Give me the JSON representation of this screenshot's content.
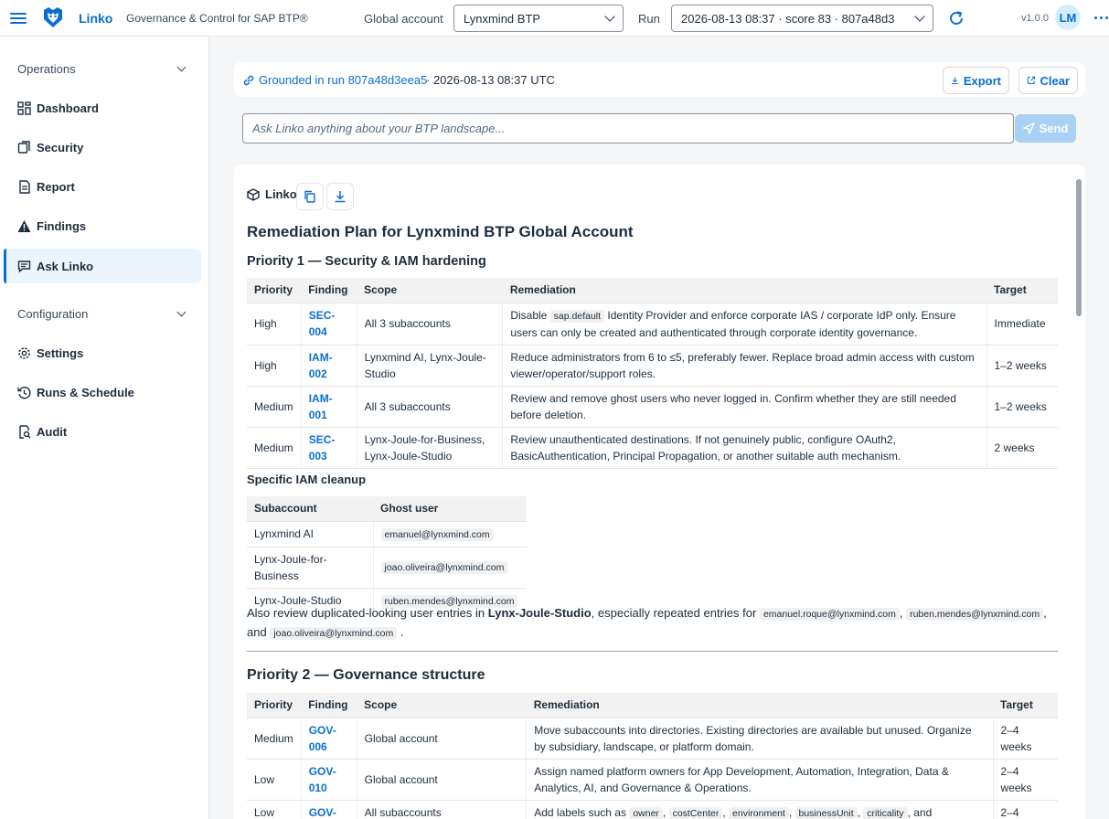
{
  "header": {
    "brand": "Linko",
    "tagline": "Governance & Control for SAP BTP®",
    "global_account_label": "Global account",
    "global_account_value": "Lynxmind BTP",
    "run_label": "Run",
    "run_value": "2026-08-13 08:37 · score 83 · 807a48d3",
    "version": "v1.0.0",
    "avatar_initials": "LM"
  },
  "sidebar": {
    "groups": [
      {
        "label": "Operations"
      },
      {
        "label": "Configuration"
      }
    ],
    "items": [
      {
        "label": "Dashboard",
        "icon": "dashboard-icon"
      },
      {
        "label": "Security",
        "icon": "security-icon"
      },
      {
        "label": "Report",
        "icon": "report-icon"
      },
      {
        "label": "Findings",
        "icon": "warning-icon"
      },
      {
        "label": "Ask Linko",
        "icon": "chat-icon"
      },
      {
        "label": "Settings",
        "icon": "gear-icon"
      },
      {
        "label": "Runs & Schedule",
        "icon": "history-icon"
      },
      {
        "label": "Audit",
        "icon": "audit-icon"
      }
    ]
  },
  "run_bar": {
    "grounded_link": "Grounded in run 807a48d3eea5",
    "timestamp": "· 2026-08-13 08:37 UTC",
    "export_label": "Export",
    "clear_label": "Clear"
  },
  "ask": {
    "placeholder": "Ask Linko anything about your BTP landscape...",
    "send_label": "Send"
  },
  "answer": {
    "author": "Linko",
    "title": "Remediation Plan for Lynxmind BTP Global Account",
    "p1_title": "Priority 1 — Security & IAM hardening",
    "p1_headers": [
      "Priority",
      "Finding",
      "Scope",
      "Remediation",
      "Target"
    ],
    "p1_rows": [
      {
        "priority": "High",
        "finding": "SEC-004",
        "scope": "All 3 subaccounts",
        "rem_before": "Disable ",
        "rem_code": "sap.default",
        "rem_after": " Identity Provider and enforce corporate IAS / corporate IdP only. Ensure users can only be created and authenticated through corporate identity governance.",
        "target": "Immediate"
      },
      {
        "priority": "High",
        "finding": "IAM-002",
        "scope": "Lynxmind AI, Lynx-Joule-Studio",
        "rem": "Reduce administrators from 6 to ≤5, preferably fewer. Replace broad admin access with custom viewer/operator/support roles.",
        "target": "1–2 weeks"
      },
      {
        "priority": "Medium",
        "finding": "IAM-001",
        "scope": "All 3 subaccounts",
        "rem": "Review and remove ghost users who never logged in. Confirm whether they are still needed before deletion.",
        "target": "1–2 weeks"
      },
      {
        "priority": "Medium",
        "finding": "SEC-003",
        "scope": "Lynx-Joule-for-Business, Lynx-Joule-Studio",
        "rem": "Review unauthenticated destinations. If not genuinely public, configure OAuth2, BasicAuthentication, Principal Propagation, or another suitable auth mechanism.",
        "target": "2 weeks"
      }
    ],
    "iam_title": "Specific IAM cleanup",
    "iam_headers": [
      "Subaccount",
      "Ghost user"
    ],
    "iam_rows": [
      {
        "subaccount": "Lynxmind AI",
        "user": "emanuel@lynxmind.com"
      },
      {
        "subaccount": "Lynx-Joule-for-Business",
        "user": "joao.oliveira@lynxmind.com"
      },
      {
        "subaccount": "Lynx-Joule-Studio",
        "user": "ruben.mendes@lynxmind.com"
      }
    ],
    "review_text_1": "Also review duplicated-looking user entries in ",
    "review_bold": "Lynx-Joule-Studio",
    "review_text_2": ", especially repeated entries for ",
    "review_code_1": "emanuel.roque@lynxmind.com",
    "review_sep_1": ",",
    "review_code_2": "ruben.mendes@lynxmind.com",
    "review_sep_2": ",",
    "review_and": "and",
    "review_code_3": "joao.oliveira@lynxmind.com",
    "review_end": ".",
    "p2_title": "Priority 2 — Governance structure",
    "p2_headers": [
      "Priority",
      "Finding",
      "Scope",
      "Remediation",
      "Target"
    ],
    "p2_rows": [
      {
        "priority": "Medium",
        "finding": "GOV-006",
        "scope": "Global account",
        "rem": "Move subaccounts into directories. Existing directories are available but unused. Organize by subsidiary, landscape, or platform domain.",
        "target": "2–4 weeks"
      },
      {
        "priority": "Low",
        "finding": "GOV-010",
        "scope": "Global account",
        "rem": "Assign named platform owners for App Development, Automation, Integration, Data & Analytics, AI, and Governance & Operations.",
        "target": "2–4 weeks"
      },
      {
        "priority": "Low",
        "finding": "GOV-",
        "scope": "All subaccounts",
        "rem_before": "Add labels such as ",
        "labels": [
          "owner",
          "costCenter",
          "environment",
          "businessUnit",
          "criticality"
        ],
        "rem_after": ", and",
        "target": "2–4"
      }
    ]
  }
}
